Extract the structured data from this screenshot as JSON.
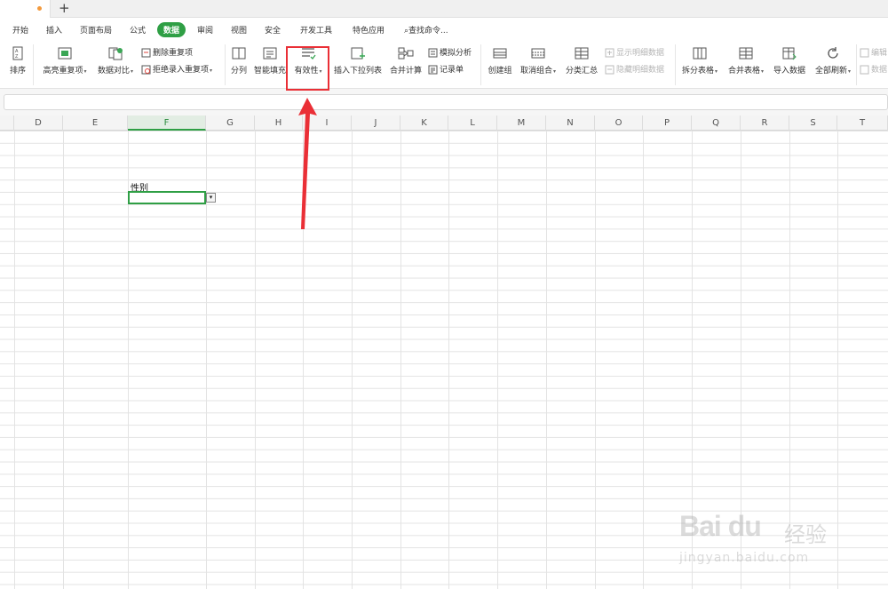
{
  "titlebar": {
    "new_tab": "+"
  },
  "menu": {
    "tabs": [
      "开始",
      "插入",
      "页面布局",
      "公式",
      "数据",
      "审阅",
      "视图",
      "安全",
      "开发工具",
      "特色应用"
    ],
    "active": "数据",
    "search": "查找命令..."
  },
  "ribbon": {
    "sort_label": "排序",
    "highlight_dup": "高亮重复项",
    "data_compare": "数据对比",
    "delete_dup": "删除重复项",
    "reject_dup": "拒绝录入重复项",
    "split_col": "分列",
    "smart_fill": "智能填充",
    "validity": "有效性",
    "insert_dropdown": "插入下拉列表",
    "consolidate": "合并计算",
    "whatif": "模拟分析",
    "record_form": "记录单",
    "create_group": "创建组",
    "ungroup": "取消组合",
    "subtotal": "分类汇总",
    "show_detail": "显示明细数据",
    "hide_detail": "隐藏明细数据",
    "split_table": "拆分表格",
    "merge_table": "合并表格",
    "import_data": "导入数据",
    "refresh_all": "全部刷新",
    "edit_query": "编辑",
    "data_prop": "数据"
  },
  "columns": [
    "D",
    "E",
    "F",
    "G",
    "H",
    "I",
    "J",
    "K",
    "L",
    "M",
    "N",
    "O",
    "P",
    "Q",
    "R",
    "S",
    "T"
  ],
  "selected_column": "F",
  "cell": {
    "label_text": "性别",
    "dropdown_glyph": "▾"
  },
  "watermark": {
    "logo": "Bai du",
    "text": "经验",
    "url": "jingyan.baidu.com"
  },
  "colors": {
    "accent": "#2f9f45",
    "highlight": "#ea2f36"
  }
}
